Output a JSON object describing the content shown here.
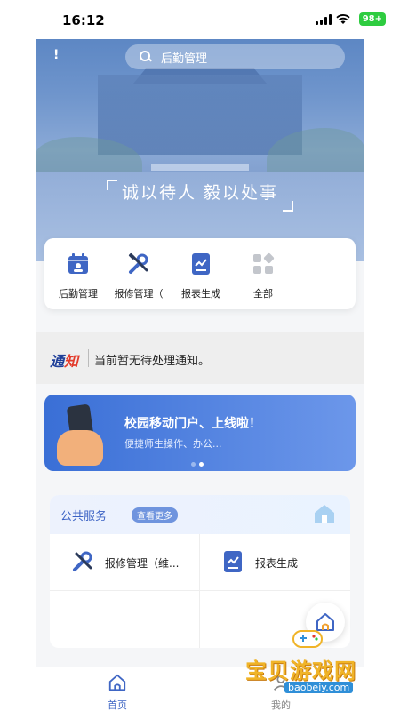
{
  "status_bar": {
    "time": "16:12",
    "battery": "98+"
  },
  "header": {
    "search_text": "后勤管理",
    "back_mark": "!"
  },
  "hero": {
    "slogan": "诚以待人  毅以处事"
  },
  "quick_actions": [
    {
      "label": "后勤管理",
      "icon": "calendar-user-icon"
    },
    {
      "label": "报修管理（",
      "icon": "repair-tools-icon"
    },
    {
      "label": "报表生成",
      "icon": "report-chart-icon"
    },
    {
      "label": "全部",
      "icon": "all-apps-icon"
    }
  ],
  "notice": {
    "logo_a": "通",
    "logo_b": "知",
    "text": "当前暂无待处理通知。"
  },
  "banner": {
    "title": "校园移动门户、上线啦！",
    "subtitle": "便捷师生操作、办公..."
  },
  "public_service": {
    "title": "公共服务",
    "more_label": "查看更多",
    "items": [
      {
        "label": "报修管理（维...",
        "icon": "repair-tools-icon"
      },
      {
        "label": "报表生成",
        "icon": "report-chart-icon"
      }
    ]
  },
  "tabbar": {
    "tabs": [
      {
        "label": "首页",
        "icon": "home-icon",
        "active": true
      },
      {
        "label": "我的",
        "icon": "profile-icon",
        "active": false
      }
    ]
  },
  "watermark": {
    "text": "宝贝游戏网",
    "url": "baobeiy.com"
  },
  "colors": {
    "accent": "#3b62c4",
    "brand_blue": "#3a6fd6",
    "notice_red": "#e33b2b"
  }
}
